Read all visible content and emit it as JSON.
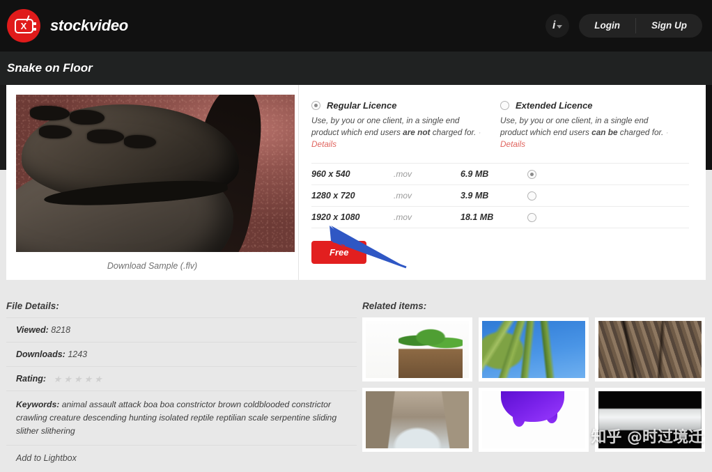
{
  "header": {
    "brand_name": "stockvideo",
    "logo_letter": "X",
    "info_icon": "info-icon",
    "login_label": "Login",
    "signup_label": "Sign Up"
  },
  "title_bar": {
    "title": "Snake on Floor"
  },
  "preview": {
    "sample_link": "Download Sample (.flv)",
    "alt": "snake head close-up on reddish sand"
  },
  "licences": [
    {
      "name": "Regular Licence",
      "desc_pre": "Use, by you or one client, in a single end product which end users ",
      "desc_bold": "are not",
      "desc_post": " charged for.",
      "details_label": "Details",
      "selected": true
    },
    {
      "name": "Extended Licence",
      "desc_pre": "Use, by you or one client, in a single end product which end users ",
      "desc_bold": "can be",
      "desc_post": " charged for.",
      "details_label": "Details",
      "selected": false
    }
  ],
  "resolutions": [
    {
      "dimensions": "960 x 540",
      "format": ".mov",
      "size": "6.9 MB",
      "selected": true
    },
    {
      "dimensions": "1280 x 720",
      "format": ".mov",
      "size": "3.9 MB",
      "selected": false
    },
    {
      "dimensions": "1920 x 1080",
      "format": ".mov",
      "size": "18.1 MB",
      "selected": false
    }
  ],
  "download": {
    "button_label": "Free",
    "annotation": "blue-arrow pointing at Free button"
  },
  "file_details": {
    "heading": "File Details:",
    "viewed_label": "Viewed:",
    "viewed_value": "8218",
    "downloads_label": "Downloads:",
    "downloads_value": "1243",
    "rating_label": "Rating:",
    "rating_value": 0,
    "rating_max": 5,
    "keywords_label": "Keywords:",
    "keywords": [
      "animal",
      "assault",
      "attack",
      "boa",
      "boa constrictor",
      "brown",
      "coldblooded",
      "constrictor",
      "crawling",
      "creature",
      "descending",
      "hunting",
      "isolated",
      "reptile",
      "reptilian",
      "scale",
      "serpentine",
      "sliding",
      "slither",
      "slithering"
    ],
    "lightbox_label": "Add to Lightbox"
  },
  "related": {
    "heading": "Related items:",
    "items": [
      {
        "name": "palm-tree-white",
        "style": "t-palm"
      },
      {
        "name": "palm-fronds-sky",
        "style": "t-frond"
      },
      {
        "name": "rock-bark-texture",
        "style": "t-rock"
      },
      {
        "name": "canyon-stream",
        "style": "t-canyon"
      },
      {
        "name": "purple-liquid-drip",
        "style": "t-purple"
      },
      {
        "name": "white-band-black",
        "style": "t-black"
      }
    ]
  },
  "watermark": {
    "text": "知乎 @时过境迁"
  },
  "colors": {
    "header_bg": "#111111",
    "titlebar_bg": "#202222",
    "page_bg": "#e8e8e8",
    "accent_red": "#e21f1f",
    "link_red": "#e0655f",
    "arrow_blue": "#2f57c4"
  }
}
